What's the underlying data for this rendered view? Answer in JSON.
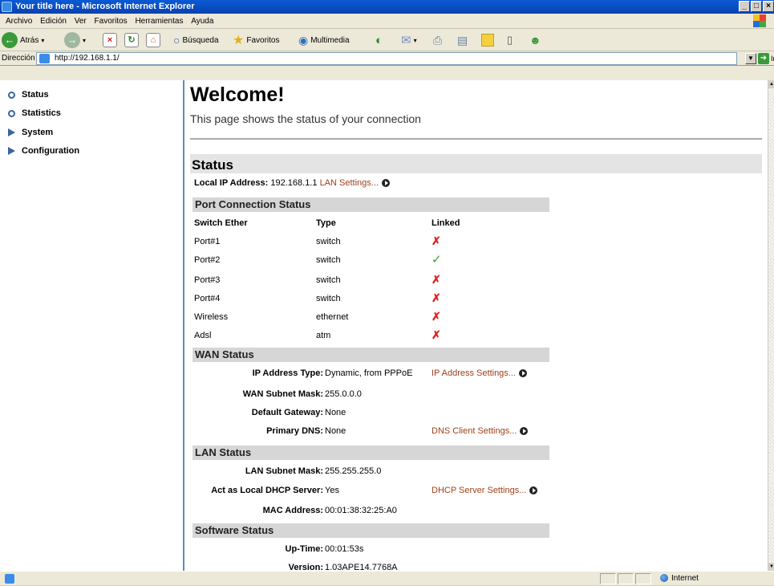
{
  "window": {
    "title": "Your title here - Microsoft Internet Explorer"
  },
  "menu": [
    "Archivo",
    "Edición",
    "Ver",
    "Favoritos",
    "Herramientas",
    "Ayuda"
  ],
  "toolbar": {
    "back": "Atrás",
    "search": "Búsqueda",
    "favorites": "Favoritos",
    "multimedia": "Multimedia"
  },
  "address": {
    "label": "Dirección",
    "url": "http://192.168.1.1/",
    "go": "Ir"
  },
  "sidebar": {
    "items": [
      {
        "label": "Status"
      },
      {
        "label": "Statistics"
      },
      {
        "label": "System"
      },
      {
        "label": "Configuration"
      }
    ]
  },
  "page": {
    "welcome": "Welcome!",
    "subtitle": "This page shows the status of your connection",
    "status_heading": "Status",
    "local_ip_label": "Local IP Address:",
    "local_ip": "192.168.1.1",
    "lan_settings_link": "LAN Settings...",
    "port_heading": "Port Connection Status",
    "port_columns": [
      "Switch Ether",
      "Type",
      "Linked"
    ],
    "ports": [
      {
        "name": "Port#1",
        "type": "switch",
        "linked": "✗"
      },
      {
        "name": "Port#2",
        "type": "switch",
        "linked": "✓"
      },
      {
        "name": "Port#3",
        "type": "switch",
        "linked": "✗"
      },
      {
        "name": "Port#4",
        "type": "switch",
        "linked": "✗"
      },
      {
        "name": "Wireless",
        "type": "ethernet",
        "linked": "✗"
      },
      {
        "name": "Adsl",
        "type": "atm",
        "linked": "✗"
      }
    ],
    "wan_heading": "WAN Status",
    "wan": {
      "ip_type_label": "IP Address Type:",
      "ip_type": "Dynamic, from PPPoE",
      "ip_settings_link": "IP Address Settings...",
      "subnet_label": "WAN Subnet Mask:",
      "subnet": "255.0.0.0",
      "gateway_label": "Default Gateway:",
      "gateway": "None",
      "dns_label": "Primary DNS:",
      "dns": "None",
      "dns_link": "DNS Client Settings..."
    },
    "lan_heading": "LAN Status",
    "lan": {
      "subnet_label": "LAN Subnet Mask:",
      "subnet": "255.255.255.0",
      "dhcp_label": "Act as Local DHCP Server:",
      "dhcp": "Yes",
      "dhcp_link": "DHCP Server Settings...",
      "mac_label": "MAC Address:",
      "mac": "00:01:38:32:25:A0"
    },
    "software_heading": "Software Status",
    "software": {
      "uptime_label": "Up-Time:",
      "uptime": "00:01:53s",
      "version_label": "Version:",
      "version": "1.03APE14.7768A"
    }
  },
  "statusbar": {
    "zone": "Internet"
  }
}
